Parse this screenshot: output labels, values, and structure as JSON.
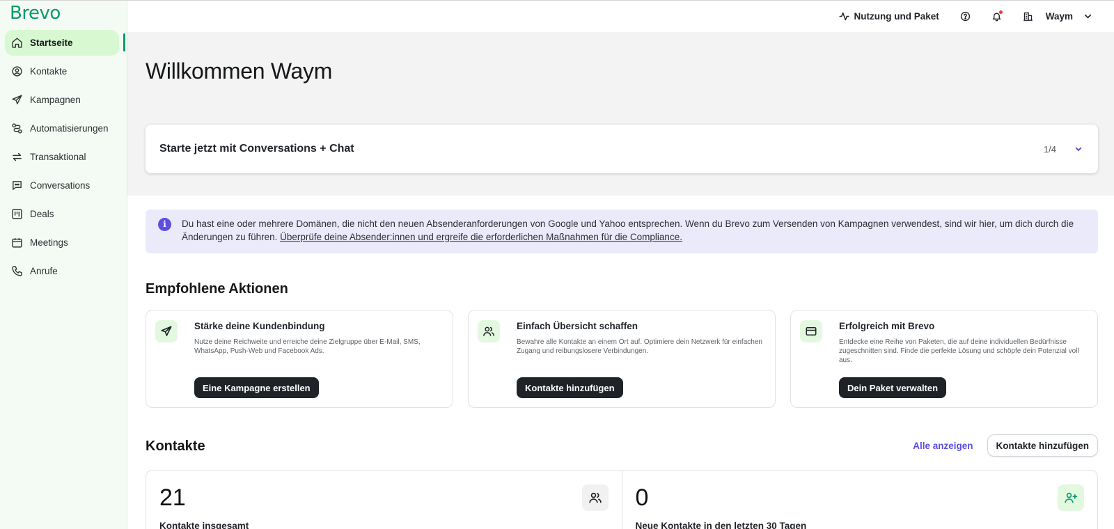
{
  "brand": {
    "name": "Brevo",
    "color": "#0b996e"
  },
  "sidebar": {
    "items": [
      {
        "label": "Startseite",
        "icon": "home-icon",
        "active": true
      },
      {
        "label": "Kontakte",
        "icon": "contact-circle-icon"
      },
      {
        "label": "Kampagnen",
        "icon": "send-icon"
      },
      {
        "label": "Automatisierungen",
        "icon": "automation-icon"
      },
      {
        "label": "Transaktional",
        "icon": "transfer-arrows-icon"
      },
      {
        "label": "Conversations",
        "icon": "chat-icon"
      },
      {
        "label": "Deals",
        "icon": "kanban-icon"
      },
      {
        "label": "Meetings",
        "icon": "calendar-icon"
      },
      {
        "label": "Anrufe",
        "icon": "phone-icon"
      }
    ]
  },
  "topbar": {
    "usage_label": "Nutzung und Paket",
    "account_name": "Waym",
    "icons": [
      "activity-icon",
      "help-icon",
      "bell-icon",
      "building-icon",
      "chevron-down-icon"
    ]
  },
  "hero": {
    "welcome": "Willkommen Waym",
    "onboarding_title": "Starte jetzt mit Conversations + Chat",
    "onboarding_step": "1/4"
  },
  "banner": {
    "text": "Du hast eine oder mehrere Domänen, die nicht den neuen Absenderanforderungen von Google und Yahoo entsprechen. Wenn du Brevo zum Versenden von Kampagnen verwendest, sind wir hier, um dich durch die Änderungen zu führen. ",
    "link": "Überprüfe deine Absender:innen und ergreife die erforderlichen Maßnahmen für die Compliance.",
    "accent": "#5b4ee0"
  },
  "recommended": {
    "title": "Empfohlene Aktionen",
    "cards": [
      {
        "icon": "send-icon",
        "title": "Stärke deine Kundenbindung",
        "desc": "Nutze deine Reichweite und erreiche deine Zielgruppe über E-Mail, SMS, WhatsApp, Push-Web und Facebook Ads.",
        "button": "Eine Kampagne erstellen"
      },
      {
        "icon": "users-icon",
        "title": "Einfach Übersicht schaffen",
        "desc": "Bewahre alle Kontakte an einem Ort auf. Optimiere dein Netzwerk für einfachen Zugang und reibungslosere Verbindungen.",
        "button": "Kontakte hinzufügen"
      },
      {
        "icon": "credit-card-icon",
        "title": "Erfolgreich mit Brevo",
        "desc": "Entdecke eine Reihe von Paketen, die auf deine individuellen Bedürfnisse zugeschnitten sind. Finde die perfekte Lösung und schöpfe dein Potenzial voll aus.",
        "button": "Dein Paket verwalten"
      }
    ]
  },
  "contacts": {
    "title": "Kontakte",
    "view_all": "Alle anzeigen",
    "add_button": "Kontakte hinzufügen",
    "stats": [
      {
        "value": "21",
        "label": "Kontakte insgesamt",
        "icon": "users-icon"
      },
      {
        "value": "0",
        "label": "Neue Kontakte in den letzten 30 Tagen",
        "icon": "user-plus-icon"
      }
    ]
  }
}
